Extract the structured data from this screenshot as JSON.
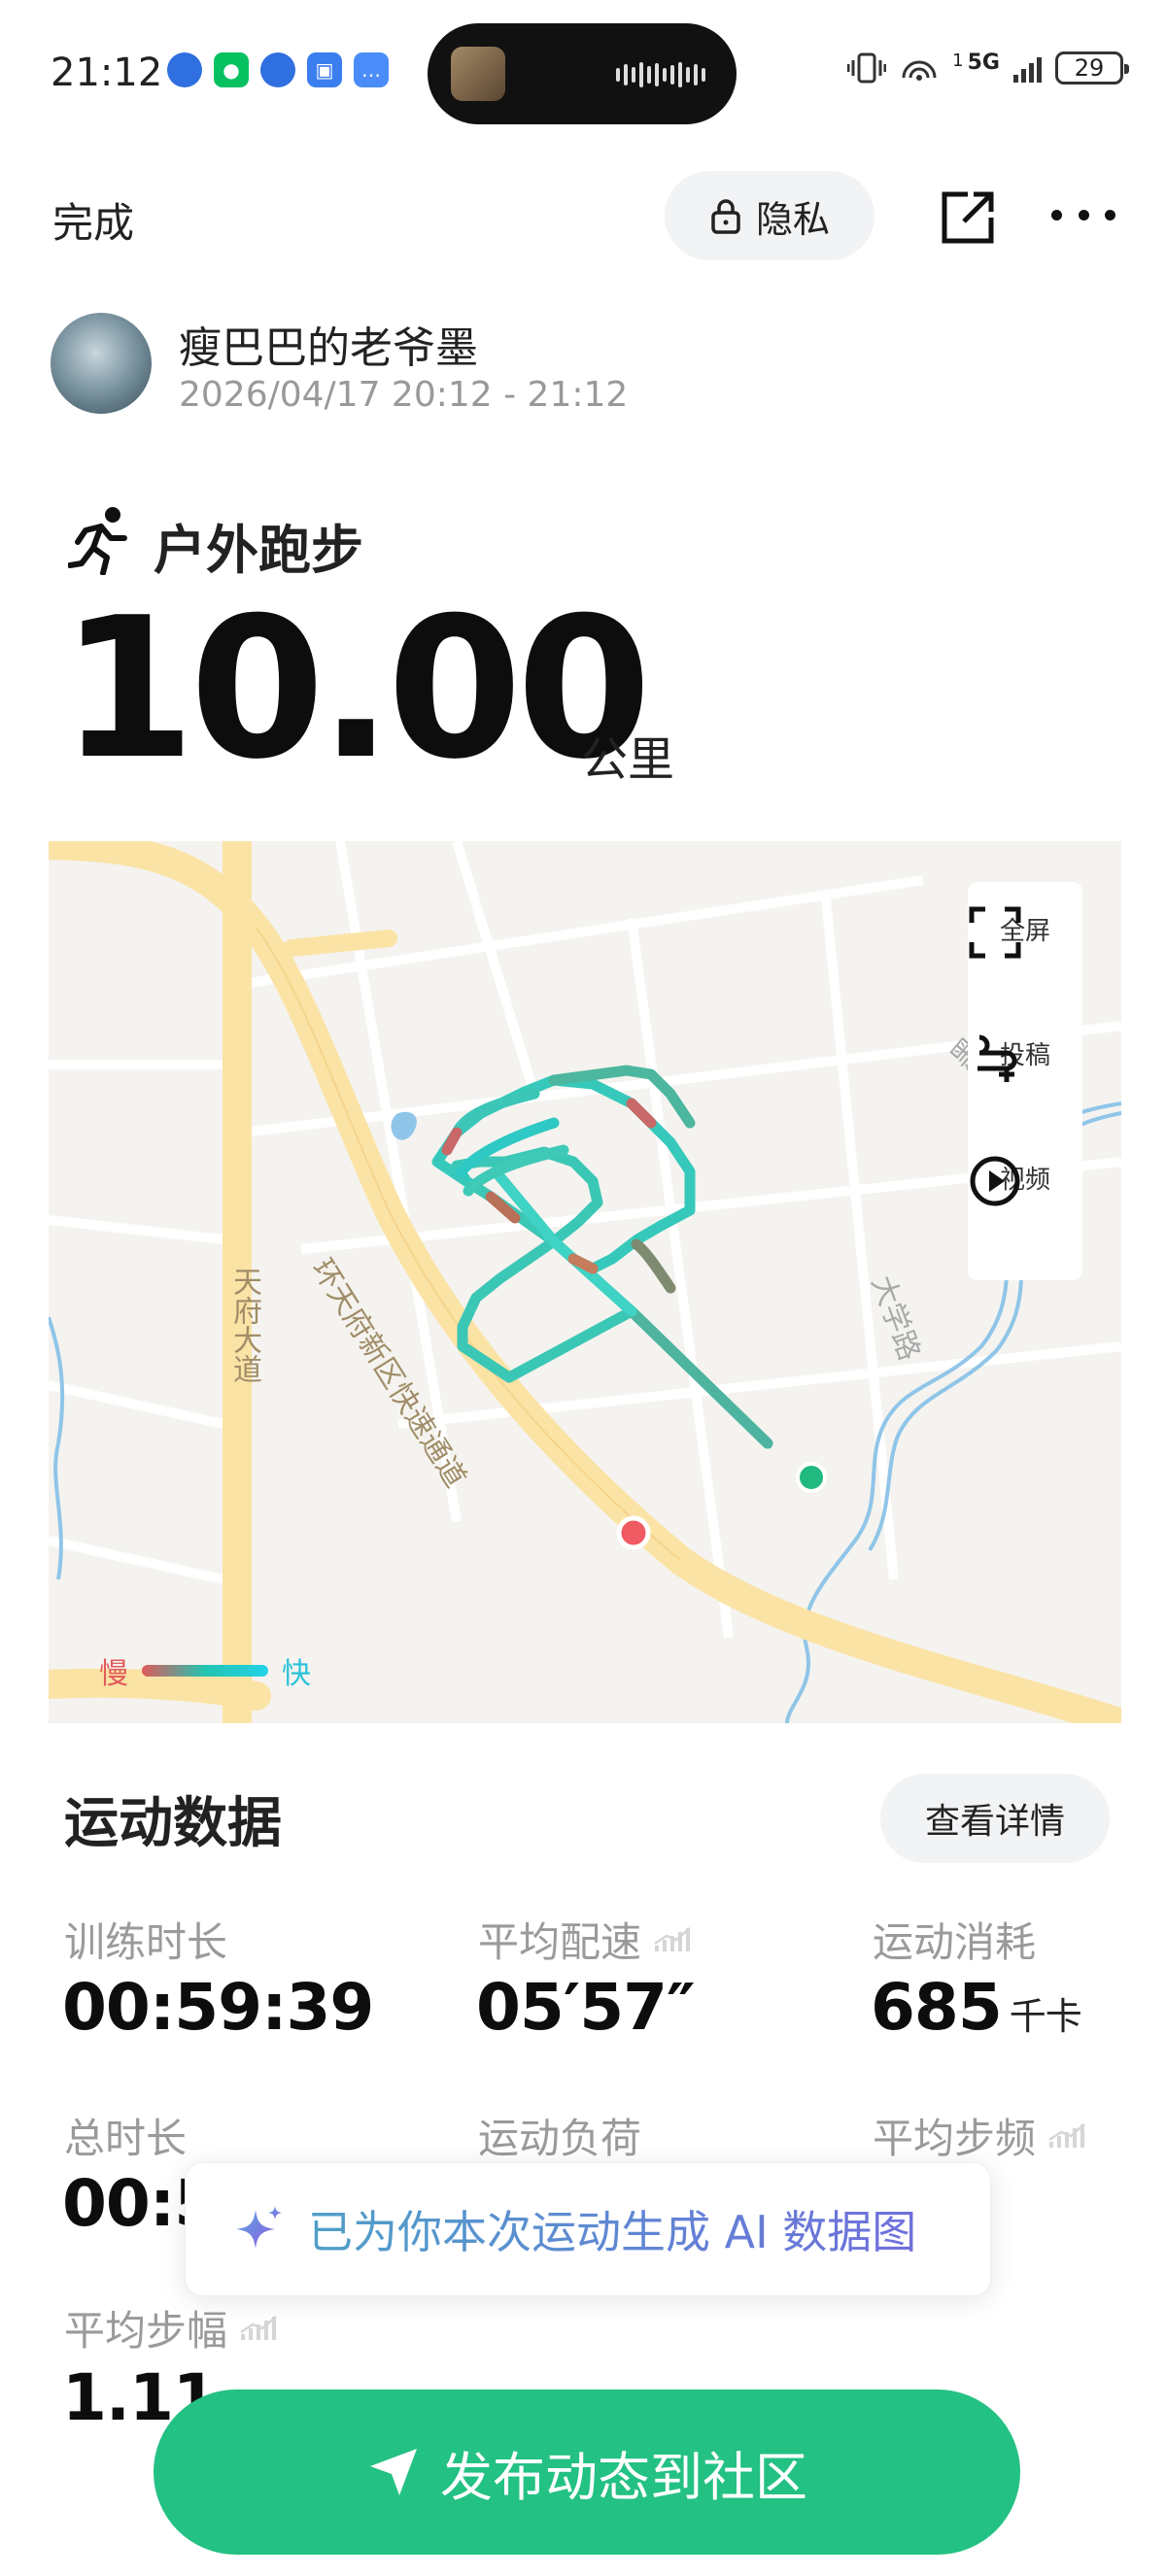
{
  "status_bar": {
    "time": "21:12",
    "network": "5G",
    "signal_sup": "1",
    "battery": "29"
  },
  "top_bar": {
    "done": "完成",
    "privacy": "隐私"
  },
  "user": {
    "name": "瘦巴巴的老爷墨",
    "datetime": "2026/04/17 20:12 - 21:12"
  },
  "activity": {
    "type": "户外跑步",
    "distance": "10.00",
    "unit": "公里"
  },
  "map": {
    "labels": {
      "road_tianfu": "天府大道",
      "road_ring": "环天府新区快速通道",
      "road_daxu": "大学路",
      "road_hei": "黑大路"
    },
    "tools": {
      "fullscreen": "全屏",
      "submit": "投稿",
      "video": "视频"
    },
    "legend": {
      "slow": "慢",
      "fast": "快"
    },
    "colors": {
      "start": "#21b97f",
      "end": "#f05a63",
      "road": "#fbe3a5",
      "water": "#8fc5e8"
    }
  },
  "stats": {
    "section_title": "运动数据",
    "detail_button": "查看详情",
    "items": [
      {
        "label": "训练时长",
        "value": "00:59:39",
        "unit": ""
      },
      {
        "label": "平均配速",
        "value": "05′57″",
        "unit": ""
      },
      {
        "label": "运动消耗",
        "value": "685",
        "unit": "千卡"
      },
      {
        "label": "总时长",
        "value": "00:5",
        "unit": ""
      },
      {
        "label": "运动负荷",
        "value": "",
        "unit": ""
      },
      {
        "label": "平均步频",
        "value": "",
        "unit": ""
      },
      {
        "label": "平均步幅",
        "value": "1.11",
        "unit": ""
      }
    ]
  },
  "ai_tip": "已为你本次运动生成 AI 数据图",
  "publish_button": "发布动态到社区"
}
